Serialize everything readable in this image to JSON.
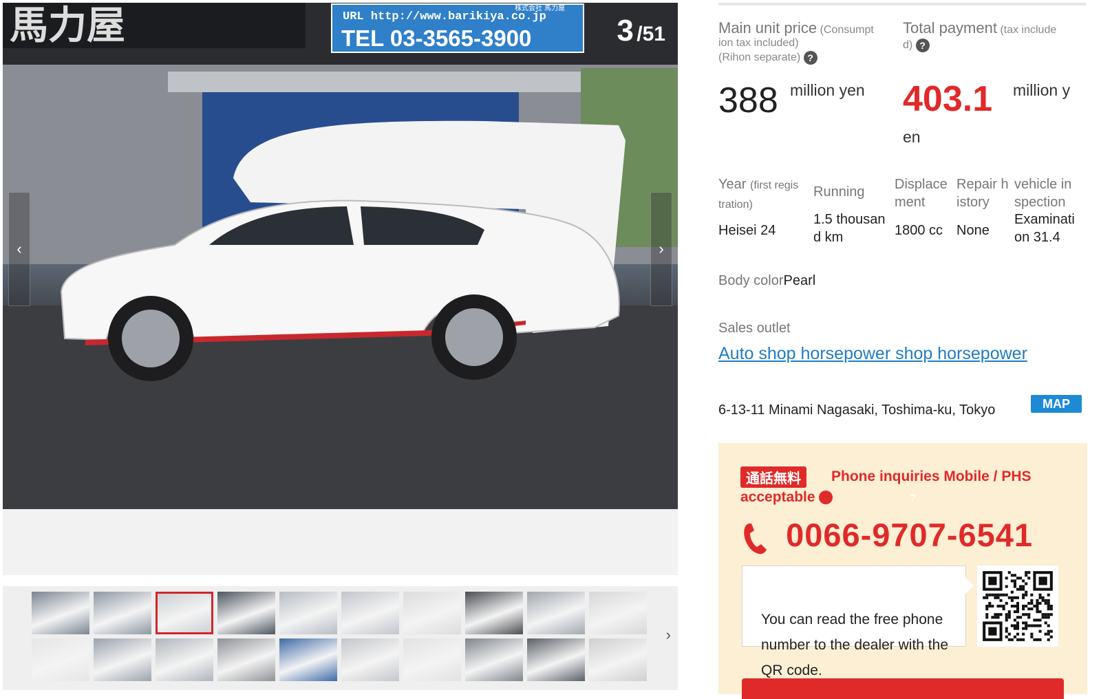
{
  "gallery": {
    "counter_current": "3",
    "counter_total": "/51",
    "sign_url": "URL http://www.barikiya.co.jp",
    "sign_small": "株式会社 馬力屋",
    "sign_tel": "TEL 03-3565-3900",
    "sign_shop": "馬力屋",
    "prev_icon": "‹",
    "next_icon": "›",
    "thumb_next_icon": "›",
    "selected_thumb_index": 2,
    "thumbnails": [
      "#7a8592",
      "#8d97a3",
      "#c9ccd1",
      "#4d5560",
      "#b7bcc3",
      "#c2c5cb",
      "#dcdcdc",
      "#4a4d52",
      "#a2a8b0",
      "#d8d8d8",
      "#e6e6e6",
      "#9ba3ad",
      "#b0b5bb",
      "#8e9196",
      "#3e6aa8",
      "#c4c6ca",
      "#e2e2e2",
      "#7f858c",
      "#5b6068",
      "#cfcfcf"
    ]
  },
  "price": {
    "main_label": "Main unit price",
    "main_note_1": "(Consumpt",
    "main_note_2": "ion tax included)",
    "main_note_3": "(Rihon separate)",
    "main_value": "388",
    "main_unit": "million yen",
    "total_label": "Total payment",
    "total_note_1": "(tax include",
    "total_note_2": "d)",
    "total_value": "403.1",
    "total_unit_1": "million y",
    "total_unit_2": "en",
    "help_icon": "?"
  },
  "specs": {
    "year_label": "Year",
    "year_note_1": "(first regis",
    "year_note_2": "tration)",
    "year_value": "Heisei 24",
    "running_label": "Running",
    "running_value_1": "1.5 thousan",
    "running_value_2": "d km",
    "displacement_label_1": "Displace",
    "displacement_label_2": "ment",
    "displacement_value": "1800 cc",
    "repair_label_1": "Repair h",
    "repair_label_2": "istory",
    "repair_value": "None",
    "inspection_label_1": "vehicle in",
    "inspection_label_2": "spection",
    "inspection_value_1": "Examinati",
    "inspection_value_2": "on 31.4"
  },
  "body_color": {
    "label": "Body color",
    "value": "Pearl"
  },
  "dealer": {
    "sales_label": "Sales outlet",
    "name": "Auto shop horsepower shop horsepower",
    "address": "6-13-11 Minami Nagasaki, Toshima-ku, Tokyo",
    "map_label": "MAP"
  },
  "phone": {
    "badge": "通話無料",
    "note": "Phone inquiries Mobile / PHS acceptable",
    "number": "0066-9707-6541",
    "qr_text": "You can read the free phone number to the dealer with the QR code.",
    "accent": "#e02a2a"
  }
}
